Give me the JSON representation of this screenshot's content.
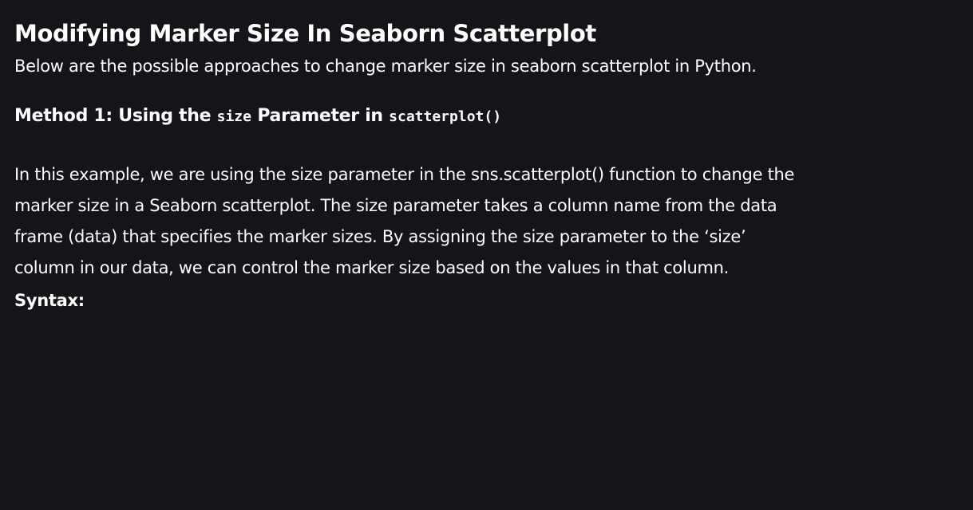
{
  "article": {
    "title": "Modifying Marker Size In Seaborn Scatterplot",
    "intro": "Below are the possible approaches to change marker size in seaborn scatterplot in Python.",
    "method1": {
      "heading_prefix": "Method 1: Using the",
      "param_code": "size",
      "heading_middle": "Parameter in",
      "function_code": "scatterplot()"
    },
    "paragraph_lines": [
      "In this example, we are using the size parameter in the sns.scatterplot() function to change the",
      "marker size in a Seaborn scatterplot. The size parameter takes a column name from the data",
      "frame (data) that specifies the marker sizes. By assigning the size parameter to the ‘size’",
      "column in our data, we can control the marker size based on the values in that column."
    ],
    "syntax_label": "Syntax:"
  }
}
